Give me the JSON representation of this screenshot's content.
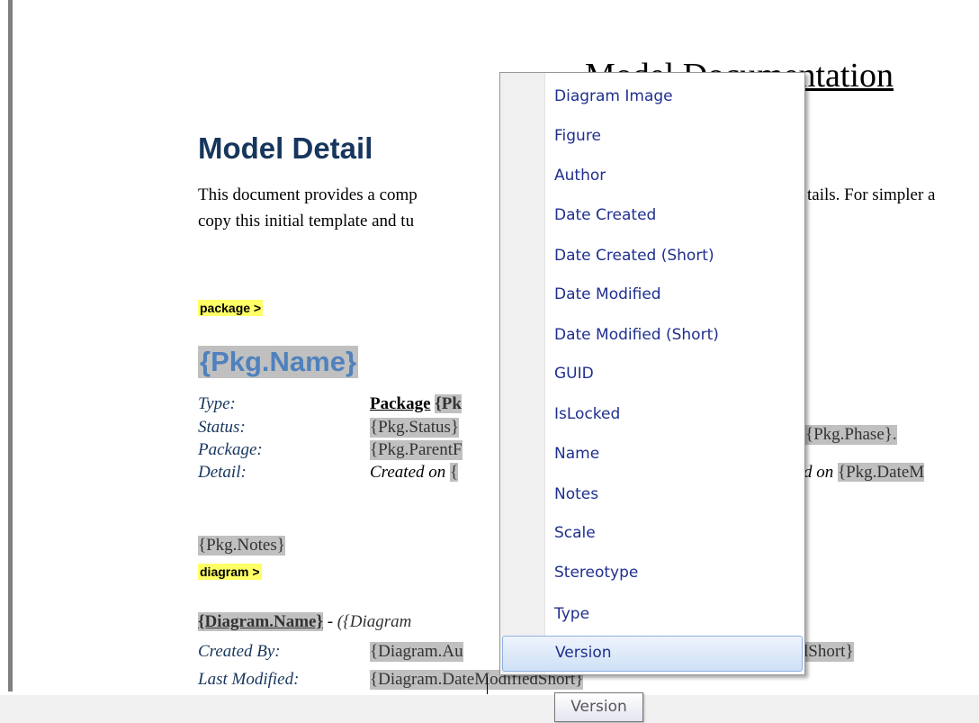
{
  "document": {
    "title": "Model Documentation",
    "heading": "Model Detail",
    "paragraph_line1": "This document provides a comp",
    "paragraph_line1_tail": "tails. For simpler a",
    "paragraph_line2": "copy this initial template and tu",
    "package_tag": "package >",
    "pkg_name": "{Pkg.Name}",
    "rows": [
      {
        "label": "Type:",
        "value": "Package",
        "value2": "{Pk"
      },
      {
        "label": "Status:",
        "value": "{Pkg.Status}",
        "tail": "{Pkg.Phase}."
      },
      {
        "label": "Package:",
        "value": "{Pkg.ParentF"
      },
      {
        "label": "Detail:",
        "value": "Created on",
        "value2": "{",
        "tail_text": "d on",
        "tail": "{Pkg.DateM"
      }
    ],
    "pkg_notes": "{Pkg.Notes}",
    "diagram_tag": "diagram >",
    "diagram_name": "{Diagram.Name}",
    "diagram_sep": " - ",
    "diagram_italic": "({Diagram",
    "created_by_label": "Created By:",
    "created_by_value": "{Diagram.Au",
    "created_by_tail": "lShort}",
    "last_modified_label": "Last Modified:",
    "last_modified_value": "{Diagram.Da",
    "last_modified_tail": "teModifiedShort}"
  },
  "context_menu": {
    "items": [
      "Diagram Image",
      "Figure",
      "Author",
      "Date Created",
      "Date Created (Short)",
      "Date Modified",
      "Date Modified (Short)",
      "GUID",
      "IsLocked",
      "Name",
      "Notes",
      "Scale",
      "Stereotype",
      "Type",
      "Version"
    ],
    "selected": "Version"
  },
  "tooltip": "Version",
  "colors": {
    "heading": "#17365d",
    "pkg_name": "#4f81bd",
    "tag_highlight": "#ffff66",
    "field_highlight": "#c0c0c0",
    "menu_text": "#1f2f8f"
  }
}
